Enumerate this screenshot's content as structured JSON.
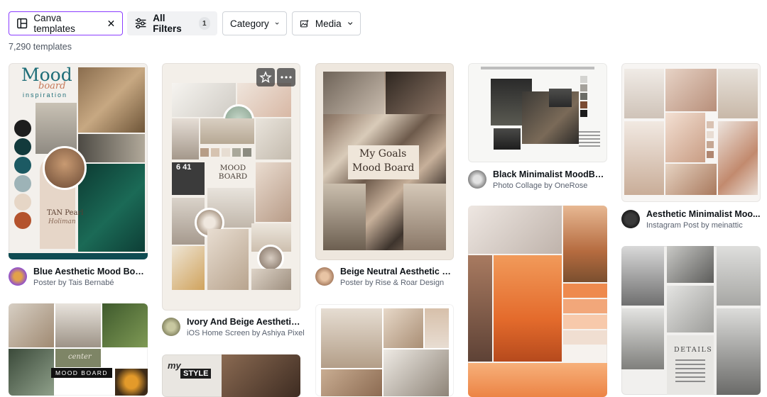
{
  "filters": {
    "chip1": "Canva templates",
    "chip2": "All Filters",
    "chip2_badge": "1",
    "chip3": "Category",
    "chip4": "Media"
  },
  "results_count": "7,290 templates",
  "cards": [
    {
      "title": "Blue Aesthetic Mood Boar...",
      "subtitle": "Poster by Tais Bernabé"
    },
    {
      "title": "Ivory And Beige Aesthetic ...",
      "subtitle": "iOS Home Screen by Ashiya Pixel"
    },
    {
      "title": "Beige Neutral Aesthetic M...",
      "subtitle": "Poster by Rise & Roar Design"
    },
    {
      "title": "Black Minimalist MoodBo...",
      "subtitle": "Photo Collage by OneRose"
    },
    {
      "title": "Aesthetic Minimalist Moo...",
      "subtitle": "Instagram Post by meinattic"
    }
  ],
  "template_text": {
    "mood": "Mood",
    "board": "board",
    "inspiration": "inspiration",
    "tan_pearl": "TAN Pearl",
    "holiman": "Holiman",
    "mood_board_caps": "MOOD BOARD",
    "mood_board_ivory": "MOOD\nBOARD",
    "time": "6 41",
    "my_goals": "My Goals",
    "mood_board_script": "Mood Board",
    "details": "DETAILS",
    "my": "my",
    "style": "STYLE",
    "center": "center"
  },
  "colors": {
    "accent": "#8b3dff",
    "swatches": [
      "#1d1d1d",
      "#123a3c",
      "#1c5a63",
      "#9db3b7",
      "#e6d6c6",
      "#b4532d"
    ]
  }
}
